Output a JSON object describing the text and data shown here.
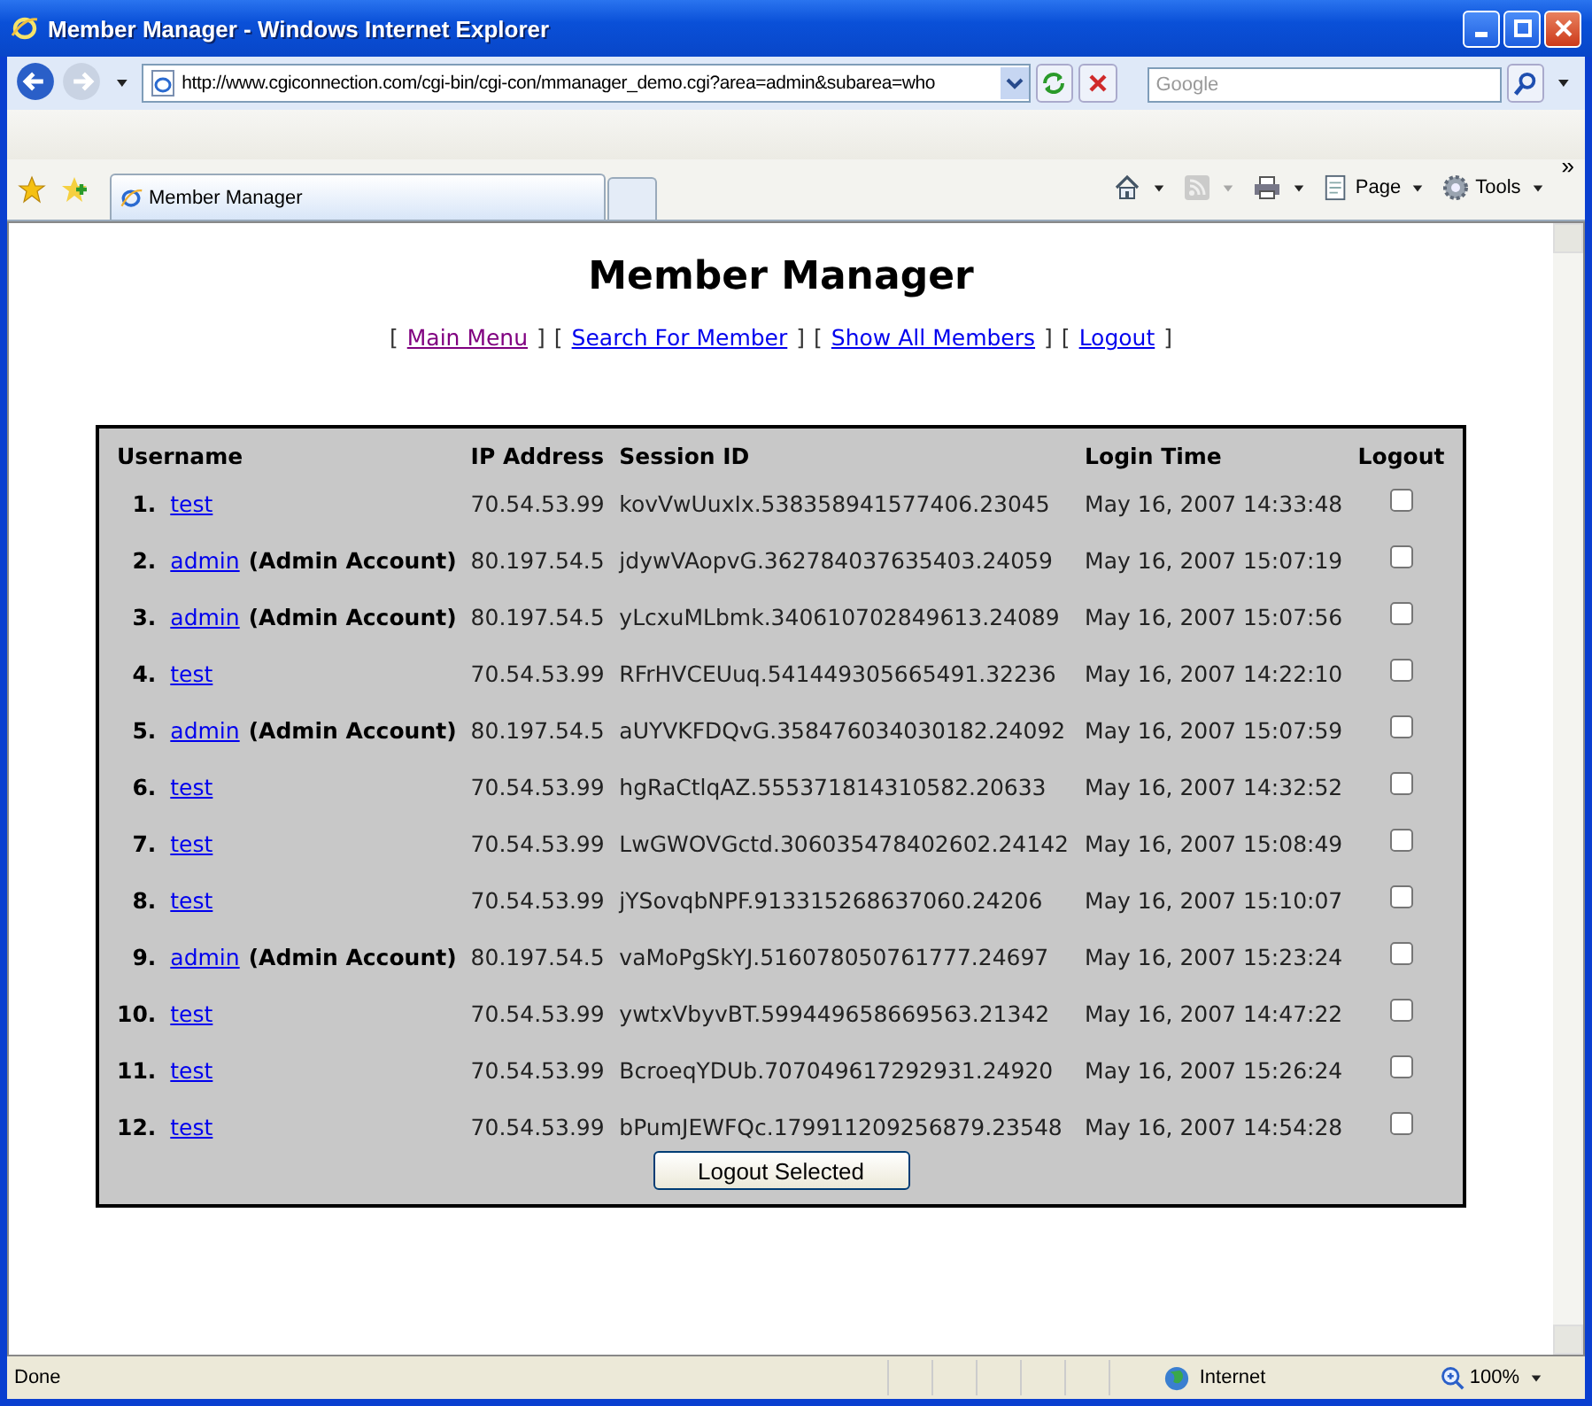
{
  "window": {
    "title": "Member Manager - Windows Internet Explorer"
  },
  "address_bar": {
    "url": "http://www.cgiconnection.com/cgi-bin/cgi-con/mmanager_demo.cgi?area=admin&subarea=who"
  },
  "search": {
    "placeholder": "Google"
  },
  "tabs": [
    {
      "label": "Member Manager",
      "selected": true
    }
  ],
  "command_bar": {
    "page": "Page",
    "tools": "Tools",
    "more": "»"
  },
  "page": {
    "heading": "Member Manager",
    "nav": [
      {
        "open": "[",
        "label": "Main Menu",
        "close": "]",
        "visited": true
      },
      {
        "open": "[",
        "label": "Search For Member",
        "close": "]",
        "visited": false
      },
      {
        "open": "[",
        "label": "Show All Members",
        "close": "]",
        "visited": false
      },
      {
        "open": "[",
        "label": "Logout",
        "close": "]",
        "visited": false
      }
    ],
    "table": {
      "columns": [
        "Username",
        "IP Address",
        "Session ID",
        "Login Time",
        "Logout"
      ],
      "rows": [
        {
          "number": "1.",
          "username": "test",
          "ip": "70.54.53.99",
          "session": "kovVwUuxIx.538358941577406.23045",
          "time": "May 16, 2007 14:33:48",
          "checked": false
        },
        {
          "number": "2.",
          "username": "admin",
          "note": "(Admin Account)",
          "ip": "80.197.54.5",
          "session": "jdywVAopvG.362784037635403.24059",
          "time": "May 16, 2007 15:07:19",
          "checked": false
        },
        {
          "number": "3.",
          "username": "admin",
          "note": "(Admin Account)",
          "ip": "80.197.54.5",
          "session": "yLcxuMLbmk.340610702849613.24089",
          "time": "May 16, 2007 15:07:56",
          "checked": false
        },
        {
          "number": "4.",
          "username": "test",
          "ip": "70.54.53.99",
          "session": "RFrHVCEUuq.541449305665491.32236",
          "time": "May 16, 2007 14:22:10",
          "checked": false
        },
        {
          "number": "5.",
          "username": "admin",
          "note": "(Admin Account)",
          "ip": "80.197.54.5",
          "session": "aUYVKFDQvG.358476034030182.24092",
          "time": "May 16, 2007 15:07:59",
          "checked": false
        },
        {
          "number": "6.",
          "username": "test",
          "ip": "70.54.53.99",
          "session": "hgRaCtlqAZ.555371814310582.20633",
          "time": "May 16, 2007 14:32:52",
          "checked": false
        },
        {
          "number": "7.",
          "username": "test",
          "ip": "70.54.53.99",
          "session": "LwGWOVGctd.306035478402602.24142",
          "time": "May 16, 2007 15:08:49",
          "checked": false
        },
        {
          "number": "8.",
          "username": "test",
          "ip": "70.54.53.99",
          "session": "jYSovqbNPF.913315268637060.24206",
          "time": "May 16, 2007 15:10:07",
          "checked": false
        },
        {
          "number": "9.",
          "username": "admin",
          "note": "(Admin Account)",
          "ip": "80.197.54.5",
          "session": "vaMoPgSkYJ.516078050761777.24697",
          "time": "May 16, 2007 15:23:24",
          "checked": false
        },
        {
          "number": "10.",
          "username": "test",
          "ip": "70.54.53.99",
          "session": "ywtxVbyvBT.599449658669563.21342",
          "time": "May 16, 2007 14:47:22",
          "checked": false
        },
        {
          "number": "11.",
          "username": "test",
          "ip": "70.54.53.99",
          "session": "BcroeqYDUb.707049617292931.24920",
          "time": "May 16, 2007 15:26:24",
          "checked": false
        },
        {
          "number": "12.",
          "username": "test",
          "ip": "70.54.53.99",
          "session": "bPumJEWFQc.179911209256879.23548",
          "time": "May 16, 2007 14:54:28",
          "checked": false
        }
      ]
    },
    "button": "Logout Selected"
  },
  "status_bar": {
    "status": "Done",
    "zone": "Internet",
    "zoom": "100%"
  }
}
